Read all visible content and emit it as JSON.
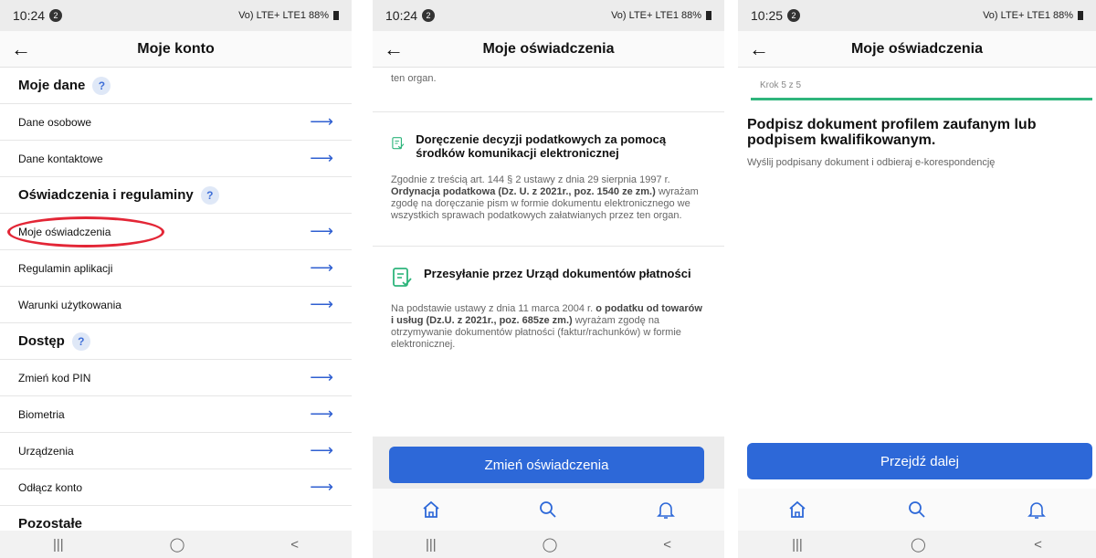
{
  "colors": {
    "accent": "#2d68d8",
    "ring": "#e32636",
    "stepbar": "#2fb57c"
  },
  "screen1": {
    "status": {
      "time": "10:24",
      "badge": "2",
      "signal": "Vo) LTE+ LTE1",
      "battery": "88%"
    },
    "title": "Moje konto",
    "sections": {
      "moje_dane": "Moje dane",
      "oswiadczenia": "Oświadczenia i regulaminy",
      "dostep": "Dostęp",
      "pozostale": "Pozostałe"
    },
    "help": "?",
    "rows": {
      "dane_osobowe": "Dane osobowe",
      "dane_kontaktowe": "Dane kontaktowe",
      "moje_oswiadczenia": "Moje oświadczenia",
      "regulamin": "Regulamin aplikacji",
      "warunki": "Warunki użytkowania",
      "pin": "Zmień kod PIN",
      "biometria": "Biometria",
      "urzadzenia": "Urządzenia",
      "odlacz": "Odłącz konto"
    },
    "arrow": "⟶"
  },
  "screen2": {
    "status": {
      "time": "10:24",
      "badge": "2",
      "signal": "Vo) LTE+ LTE1",
      "battery": "88%"
    },
    "title": "Moje oświadczenia",
    "top_text": "ten organ.",
    "card1": {
      "title": "Doręczenie decyzji podatkowych za pomocą środków komunikacji elektronicznej",
      "body_1": "Zgodnie z treścią art. 144 § 2 ustawy z dnia 29 sierpnia 1997 r. ",
      "body_bold": "Ordynacja podatkowa (Dz. U. z 2021r., poz. 1540 ze zm.)",
      "body_2": " wyrażam zgodę na doręczanie pism w formie dokumentu elektronicznego we wszystkich sprawach podatkowych załatwianych przez ten organ."
    },
    "card2": {
      "title": "Przesyłanie przez Urząd dokumentów płatności",
      "body_1": "Na podstawie ustawy z dnia 11 marca 2004 r. ",
      "body_bold": "o podatku od towarów i usług (Dz.U. z 2021r., poz. 685ze zm.)",
      "body_2": " wyrażam zgodę na otrzymywanie dokumentów płatności (faktur/rachunków) w formie elektronicznej."
    },
    "button": "Zmień oświadczenia"
  },
  "screen3": {
    "status": {
      "time": "10:25",
      "badge": "2",
      "signal": "Vo) LTE+ LTE1",
      "battery": "88%"
    },
    "title": "Moje oświadczenia",
    "step": "Krok 5 z 5",
    "step_progress": 1.0,
    "heading": "Podpisz dokument profilem zaufanym lub podpisem kwalifikowanym.",
    "subtext": "Wyślij podpisany dokument i odbieraj e-korespondencję",
    "button": "Przejdź dalej"
  },
  "nav": {
    "recents": "|||",
    "home": "◯",
    "back": "<"
  }
}
